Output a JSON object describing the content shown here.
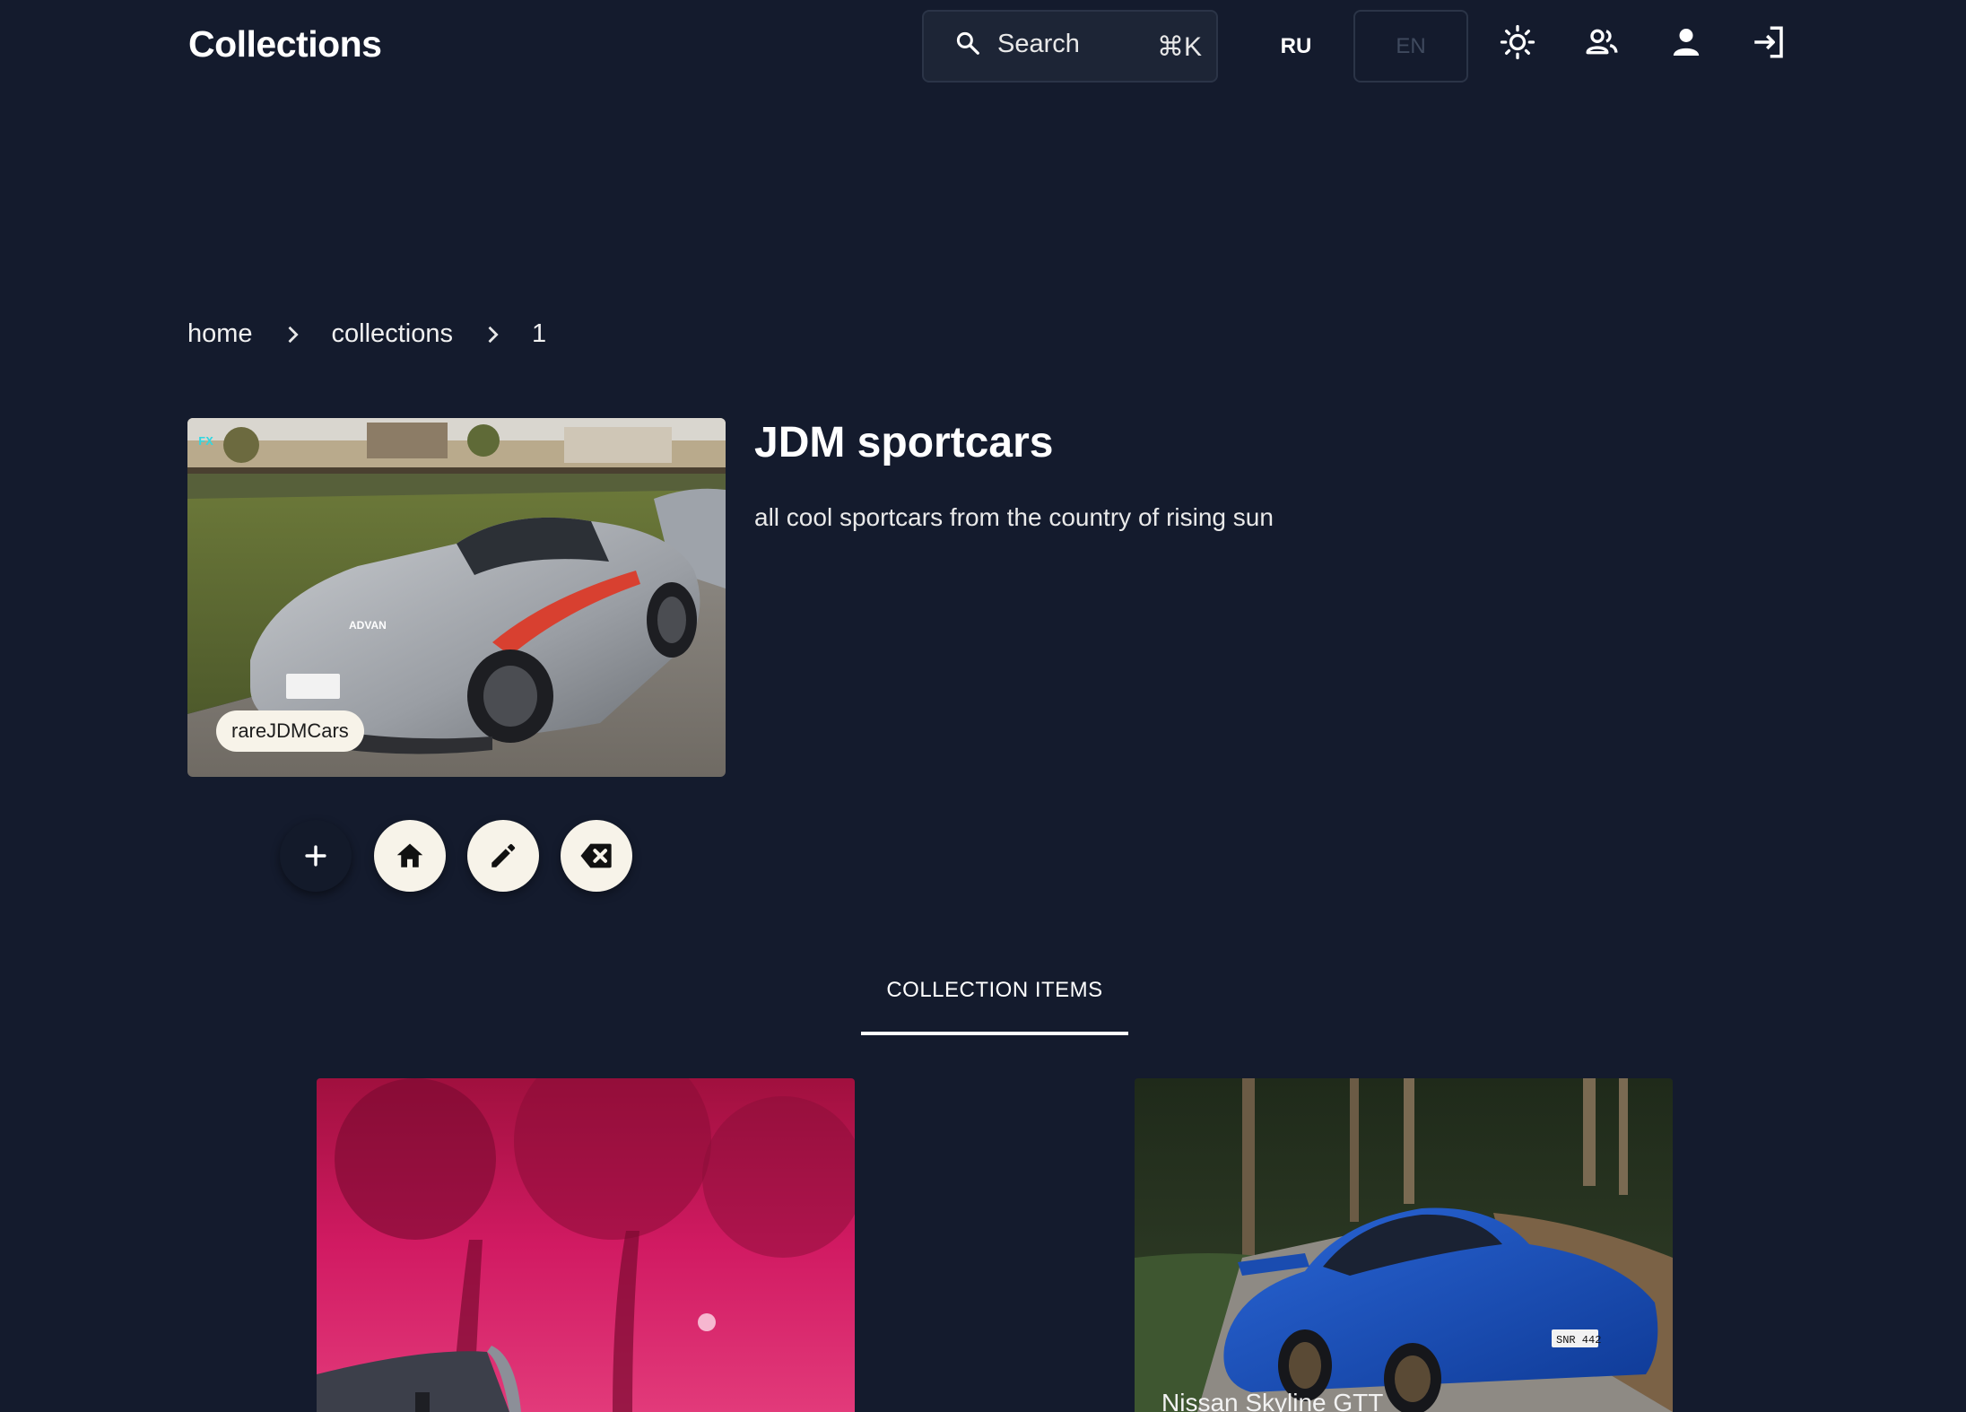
{
  "header": {
    "app_title": "Collections",
    "search": {
      "label": "Search",
      "shortcut": "⌘K"
    },
    "languages": {
      "ru": "RU",
      "en": "EN",
      "active": "EN"
    },
    "icons": [
      "sun-icon",
      "users-icon",
      "user-icon",
      "login-icon"
    ]
  },
  "breadcrumb": {
    "items": [
      "home",
      "collections",
      "1"
    ]
  },
  "collection": {
    "title": "JDM sportcars",
    "description": "all cool sportcars from the country of rising sun",
    "tag": "rareJDMCars"
  },
  "actions": {
    "icons": [
      "plus-icon",
      "home-icon",
      "pencil-icon",
      "backspace-delete-icon"
    ]
  },
  "tabs": {
    "active": "COLLECTION ITEMS"
  },
  "items": [
    {
      "title": ""
    },
    {
      "title": "Nissan Skyline GTT"
    }
  ],
  "colors": {
    "background": "#141b2d",
    "surface": "#1d2536",
    "chip": "#f7f3e9",
    "text": "#ffffff"
  }
}
